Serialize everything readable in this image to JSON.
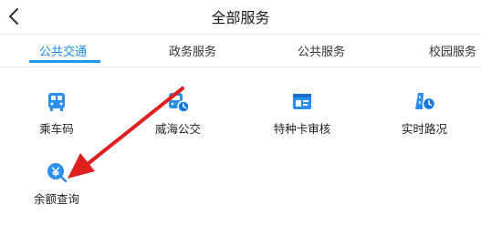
{
  "header": {
    "title": "全部服务"
  },
  "tabs": [
    {
      "label": "公共交通",
      "active": true
    },
    {
      "label": "政务服务",
      "active": false
    },
    {
      "label": "公共服务",
      "active": false
    },
    {
      "label": "校园服务",
      "active": false
    }
  ],
  "services": [
    {
      "label": "乘车码",
      "icon": "bus-icon"
    },
    {
      "label": "威海公交",
      "icon": "bus-time-icon"
    },
    {
      "label": "特种卡审核",
      "icon": "id-card-icon"
    },
    {
      "label": "实时路况",
      "icon": "road-time-icon"
    },
    {
      "label": "余额查询",
      "icon": "yuan-search-icon"
    }
  ],
  "colors": {
    "accent": "#2196f3",
    "arrow": "#e02020"
  }
}
